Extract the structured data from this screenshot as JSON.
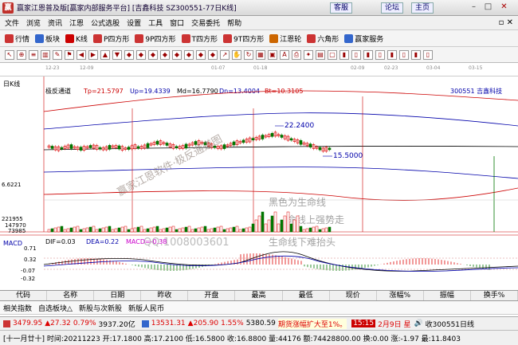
{
  "titlebar": {
    "title": "赢家江恩普及版[赢家内部服务平台] [吉鑫科技 SZ300551-77日K线]",
    "btn_service": "客服",
    "btn_forum": "论坛",
    "btn_home": "主页"
  },
  "menu": [
    "文件",
    "浏览",
    "资讯",
    "江恩",
    "公式选股",
    "设置",
    "工具",
    "窗口",
    "交易委托",
    "帮助"
  ],
  "toolbar1": [
    {
      "label": "行情",
      "icon": "grid-icon",
      "color": "#c33"
    },
    {
      "label": "板块",
      "icon": "sector-icon",
      "color": "#36c"
    },
    {
      "label": "K线",
      "icon": "kline-icon",
      "color": "#c00"
    },
    {
      "label": "P四方形",
      "icon": "square-p-icon",
      "color": "#c33"
    },
    {
      "label": "9P四方形",
      "icon": "square-9p-icon",
      "color": "#c33"
    },
    {
      "label": "T四方形",
      "icon": "square-t-icon",
      "color": "#c33"
    },
    {
      "label": "9T四方形",
      "icon": "square-9t-icon",
      "color": "#c33"
    },
    {
      "label": "江恩轮",
      "icon": "gann-wheel-icon",
      "color": "#c60"
    },
    {
      "label": "六角形",
      "icon": "hexagon-icon",
      "color": "#c33"
    },
    {
      "label": "赢家服务",
      "icon": "service-icon",
      "color": "#36c"
    }
  ],
  "toolbar3_dates": [
    "12-23",
    "12-09",
    "01-07",
    "01-18",
    "02-09",
    "02-23",
    "03-04",
    "03-15"
  ],
  "chart": {
    "period_label": "日K线",
    "indicator_name": "极反通道",
    "tp": "Tp=21.5797",
    "up": "Up=19.4339",
    "md": "Md=16.7790",
    "dn": "Dn=13.4004",
    "bt": "Bt=10.3105",
    "stock_code": "300551 吉鑫科技",
    "high_label": "22.2400",
    "low_label": "15.5000",
    "y_bottom": "6.6221",
    "vol_labels": [
      "221955",
      "147970",
      "73985"
    ],
    "watermark": "赢家江恩软件·极反通道图",
    "annotation": [
      "黑色为生命线",
      "命线上强势走",
      "生命线下难抬头"
    ],
    "qq_watermark": "QQ:1008003601"
  },
  "macd": {
    "label": "MACD",
    "dif": "DIF=0.03",
    "dea": "DEA=0.22",
    "macd": "MACD=-0.38",
    "ticks": [
      "0.71",
      "0.32",
      "-0.07",
      "-0.32"
    ]
  },
  "columns": [
    "代码",
    "名称",
    "日期",
    "昨收",
    "开盘",
    "最高",
    "最低",
    "现价",
    "涨幅%",
    "振幅",
    "换手%"
  ],
  "tabs": [
    "相关指数",
    "自选板块△",
    "新股与次新股",
    "新版人民币"
  ],
  "status1": {
    "sh_index": "3479.95",
    "sh_chg": "▲27.32",
    "sh_pct": "0.79%",
    "sh_amt": "3937.20亿",
    "sz_index": "13531.31",
    "sz_chg": "▲205.90",
    "sz_pct": "1.55%",
    "sz_amt": "5380.59",
    "alert": "期货涨幅扩大至1%。",
    "time": "15:15",
    "date": "2月9日 星",
    "sound": "🔊",
    "received": "收300551日线"
  },
  "status2": "[十一月廿十] 时间:20211223 开:17.1800 高:17.2100 低:16.5800 收:16.8800 量:44176 额:74428800.00 换:0.00 涨:-1.97 最:11.8403",
  "colors": {
    "accent": "#c0302a",
    "up": "#d00",
    "down": "#070"
  }
}
